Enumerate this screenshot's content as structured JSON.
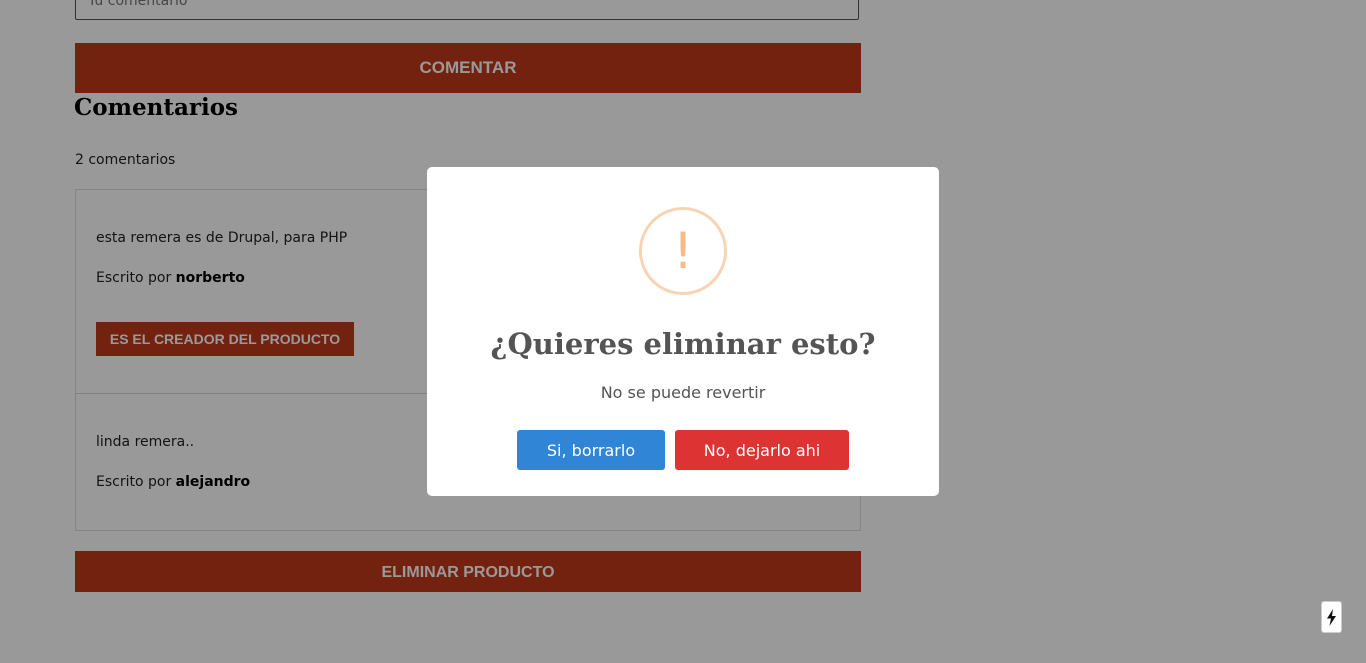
{
  "form": {
    "comment_placeholder": "Tu comentario",
    "submit_label": "Comentar"
  },
  "comments": {
    "heading": "Comentarios",
    "count_text": "2 comentarios",
    "written_by": "Escrito por",
    "items": [
      {
        "body": "esta remera es de Drupal, para PHP",
        "author": "norberto",
        "badge": "Es el creador del producto"
      },
      {
        "body": "linda remera..",
        "author": "alejandro"
      }
    ]
  },
  "product": {
    "delete_label": "Eliminar producto"
  },
  "dialog": {
    "icon": "warning-icon",
    "icon_symbol": "!",
    "title": "¿Quieres eliminar esto?",
    "text": "No se puede revertir",
    "confirm_label": "Si, borrarlo",
    "cancel_label": "No, dejarlo ahi"
  },
  "colors": {
    "brand_accent": "#c0391b",
    "confirm_button": "#3085d6",
    "cancel_button": "#dd3333",
    "warning_icon": "#f7bb87"
  },
  "widget": {
    "icon": "lightning-icon"
  }
}
